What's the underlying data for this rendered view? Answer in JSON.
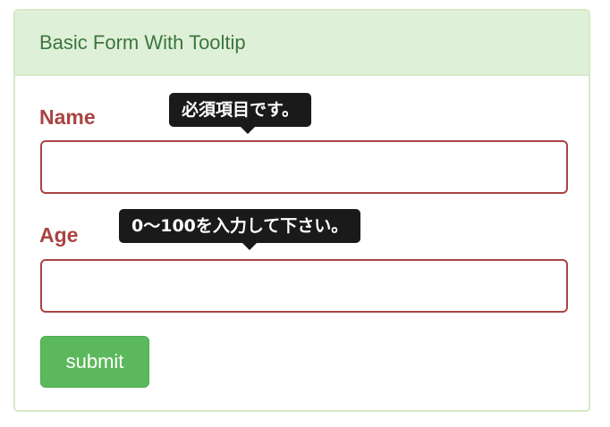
{
  "panel": {
    "title": "Basic Form With Tooltip"
  },
  "form": {
    "name_label": "Name",
    "name_value": "",
    "name_tooltip": "必須項目です。",
    "age_label": "Age",
    "age_value": "",
    "age_tooltip": "0〜100を入力して下さい。",
    "submit_label": "submit"
  },
  "colors": {
    "heading_bg": "#dff0d8",
    "heading_text": "#3c763d",
    "error": "#a94442",
    "tooltip_bg": "#1a1a1a",
    "submit_bg": "#5cb85c"
  }
}
